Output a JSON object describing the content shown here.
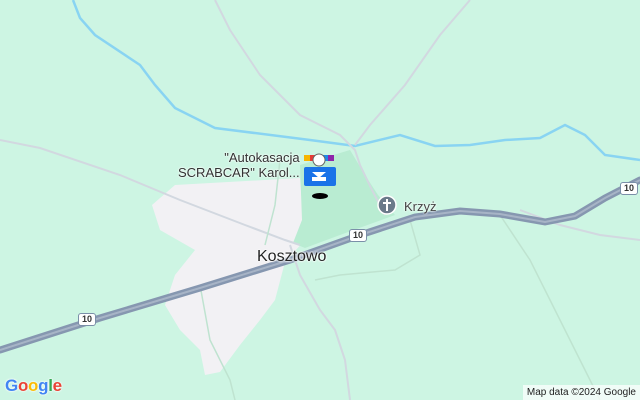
{
  "map": {
    "town_label": "Kosztowo",
    "poi_label_line1": "\"Autokasacja",
    "poi_label_line2": "SCRABCAR\" Karol...",
    "poi_icon": "car-dealer-icon",
    "cross_label": "Krzyż",
    "cross_icon": "cross-icon",
    "road_number": "10",
    "attribution": "Map data ©2024 Google",
    "logo_text": "Google",
    "colors": {
      "land": "#cdf5e3",
      "built_up": "#f2f1f4",
      "park": "#b9ecd2",
      "water": "#89d4f2",
      "highway": "#8697b0",
      "road": "#d2d8e0",
      "poi_blue": "#1a73e8"
    }
  }
}
